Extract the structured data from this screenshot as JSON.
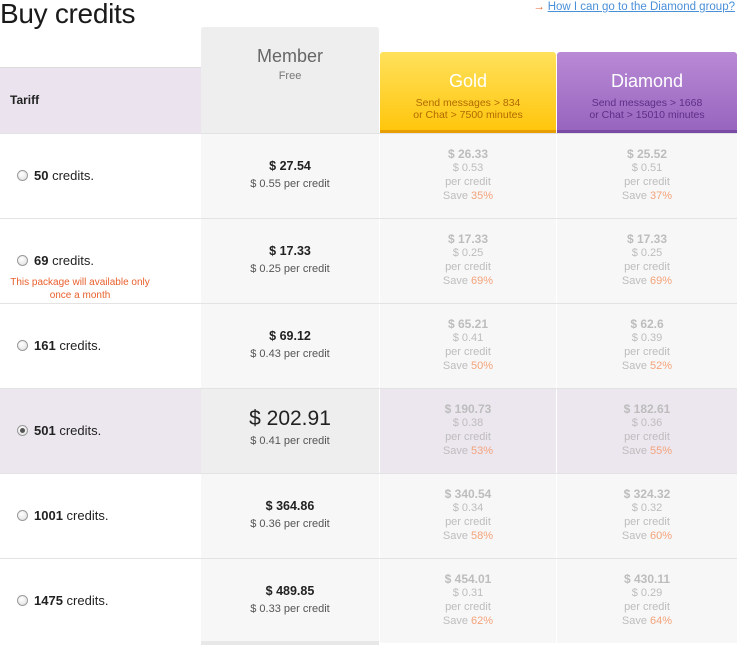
{
  "title": "Buy credits",
  "help_link": "How I can go to the Diamond group?",
  "tariff_header": "Tariff",
  "plans": {
    "member": {
      "name": "Member",
      "sub": "Free"
    },
    "gold": {
      "name": "Gold",
      "desc1": "Send messages > 834",
      "desc2": "or Chat > 7500 minutes"
    },
    "diamond": {
      "name": "Diamond",
      "desc1": "Send messages > 1668",
      "desc2": "or Chat > 15010 minutes"
    }
  },
  "credits_word": "credits.",
  "save_word": "Save",
  "per_credit_word": "per credit",
  "rows": [
    {
      "credits": "50",
      "selected": false,
      "note": "",
      "member": {
        "price": "$ 27.54",
        "per": "$ 0.55 per credit"
      },
      "gold": {
        "price": "$ 26.33",
        "per": "$ 0.53",
        "save": "35%"
      },
      "diamond": {
        "price": "$ 25.52",
        "per": "$ 0.51",
        "save": "37%"
      }
    },
    {
      "credits": "69",
      "selected": false,
      "note": "This package will available only once a month",
      "member": {
        "price": "$ 17.33",
        "per": "$ 0.25 per credit"
      },
      "gold": {
        "price": "$ 17.33",
        "per": "$ 0.25",
        "save": "69%"
      },
      "diamond": {
        "price": "$ 17.33",
        "per": "$ 0.25",
        "save": "69%"
      }
    },
    {
      "credits": "161",
      "selected": false,
      "note": "",
      "member": {
        "price": "$ 69.12",
        "per": "$ 0.43 per credit"
      },
      "gold": {
        "price": "$ 65.21",
        "per": "$ 0.41",
        "save": "50%"
      },
      "diamond": {
        "price": "$ 62.6",
        "per": "$ 0.39",
        "save": "52%"
      }
    },
    {
      "credits": "501",
      "selected": true,
      "note": "",
      "member": {
        "price": "$ 202.91",
        "per": "$ 0.41 per credit"
      },
      "gold": {
        "price": "$ 190.73",
        "per": "$ 0.38",
        "save": "53%"
      },
      "diamond": {
        "price": "$ 182.61",
        "per": "$ 0.36",
        "save": "55%"
      }
    },
    {
      "credits": "1001",
      "selected": false,
      "note": "",
      "member": {
        "price": "$ 364.86",
        "per": "$ 0.36 per credit"
      },
      "gold": {
        "price": "$ 340.54",
        "per": "$ 0.34",
        "save": "58%"
      },
      "diamond": {
        "price": "$ 324.32",
        "per": "$ 0.32",
        "save": "60%"
      }
    },
    {
      "credits": "1475",
      "selected": false,
      "note": "",
      "member": {
        "price": "$ 489.85",
        "per": "$ 0.33 per credit"
      },
      "gold": {
        "price": "$ 454.01",
        "per": "$ 0.31",
        "save": "62%"
      },
      "diamond": {
        "price": "$ 430.11",
        "per": "$ 0.29",
        "save": "64%"
      }
    }
  ]
}
